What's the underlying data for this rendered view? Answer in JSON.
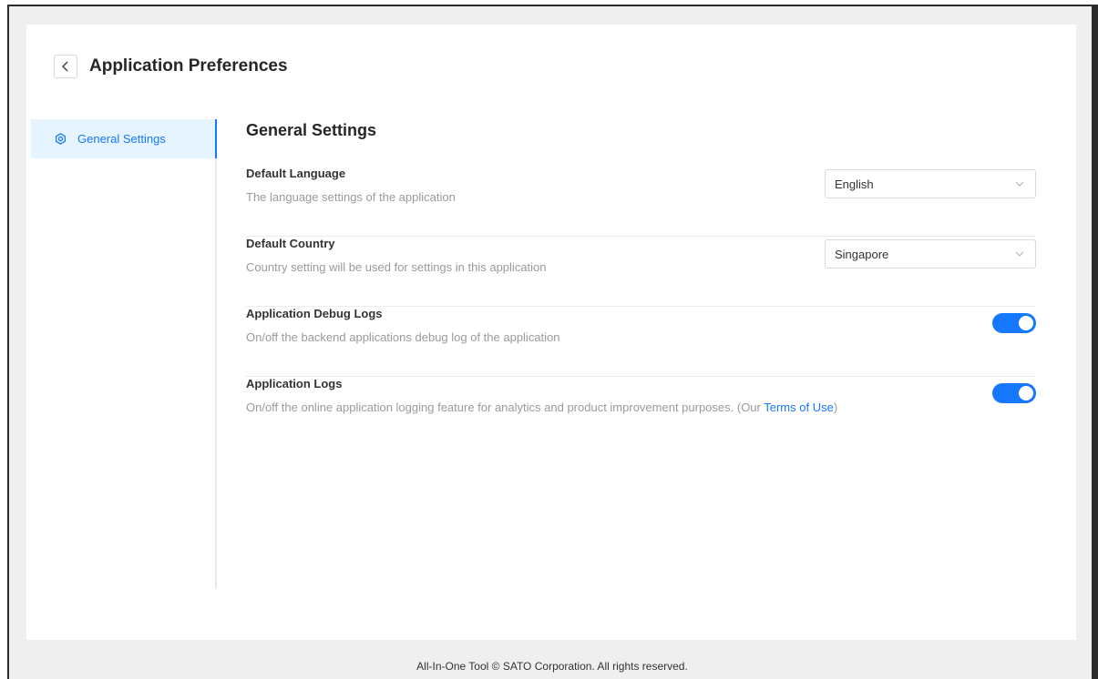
{
  "header": {
    "title": "Application Preferences"
  },
  "sidebar": {
    "items": [
      {
        "label": "General Settings",
        "icon": "gear-icon",
        "active": true
      }
    ]
  },
  "main": {
    "section_title": "General Settings",
    "settings": {
      "language": {
        "title": "Default Language",
        "description": "The language settings of the application",
        "value": "English"
      },
      "country": {
        "title": "Default Country",
        "description": "Country setting will be used for settings in this application",
        "value": "Singapore"
      },
      "debug_logs": {
        "title": "Application Debug Logs",
        "description": "On/off the backend applications debug log of the application",
        "enabled": true
      },
      "app_logs": {
        "title": "Application Logs",
        "description_prefix": "On/off the online application logging feature for analytics and product improvement purposes. (Our ",
        "link_text": "Terms of Use",
        "description_suffix": ")",
        "enabled": true
      }
    }
  },
  "footer": {
    "text": "All-In-One Tool © SATO Corporation. All rights reserved."
  },
  "colors": {
    "accent": "#1677ff",
    "active_bg": "#e6f4ff",
    "page_bg": "#efefef"
  }
}
